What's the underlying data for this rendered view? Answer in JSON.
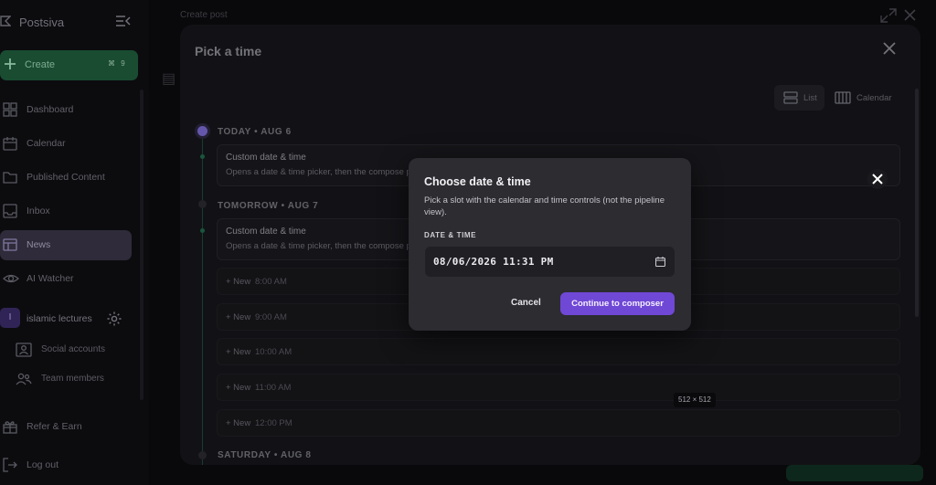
{
  "sidebar": {
    "brand": "Postsiva",
    "create": {
      "label": "Create",
      "shortcut": "⌘ 9"
    },
    "nav": [
      {
        "label": "Dashboard",
        "icon": "dashboard-icon"
      },
      {
        "label": "Calendar",
        "icon": "calendar-icon"
      },
      {
        "label": "Published Content",
        "icon": "folder-icon"
      },
      {
        "label": "Inbox",
        "icon": "inbox-icon"
      },
      {
        "label": "News",
        "icon": "news-icon",
        "active": true
      },
      {
        "label": "AI Watcher",
        "icon": "eye-icon"
      }
    ],
    "workspace": {
      "initial": "I",
      "name": "islamic lectures"
    },
    "sub_items": [
      {
        "label": "Social accounts",
        "icon": "social-accounts-icon"
      },
      {
        "label": "Team members",
        "icon": "team-icon"
      }
    ],
    "footer": [
      {
        "label": "Refer & Earn",
        "icon": "gift-icon"
      },
      {
        "label": "Log out",
        "icon": "logout-icon"
      }
    ]
  },
  "background": {
    "header_title": "Create post"
  },
  "pick_modal": {
    "title": "Pick a time",
    "view_toggle": {
      "list": "List",
      "calendar": "Calendar"
    },
    "days": [
      {
        "heading": "TODAY • AUG 6"
      },
      {
        "heading": "TOMORROW • AUG 7"
      },
      {
        "heading": "SATURDAY • AUG 8"
      }
    ],
    "custom_card": {
      "title": "Custom date & time",
      "desc": "Opens a date & time picker, then the compose p"
    },
    "new_label": "+ New",
    "slots": [
      "8:00 AM",
      "9:00 AM",
      "10:00 AM",
      "11:00 AM",
      "12:00 PM"
    ],
    "size_badge": "512 × 512"
  },
  "dialog": {
    "title": "Choose date & time",
    "description": "Pick a slot with the calendar and time controls (not the pipeline view).",
    "field_label": "DATE & TIME",
    "value": "08/06/2026 11:31 PM",
    "cancel": "Cancel",
    "continue": "Continue to composer"
  },
  "colors": {
    "accent": "#7048d6",
    "create_green": "#1f5d3c",
    "dialog_bg": "#2c2c31"
  }
}
